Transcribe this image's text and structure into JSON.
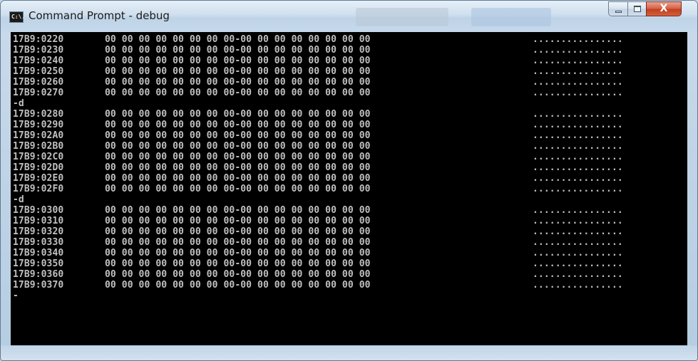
{
  "window": {
    "title": "Command Prompt - debug",
    "icon_label": "C:\\.",
    "controls": {
      "minimize": "minimize-icon",
      "maximize": "maximize-icon",
      "close": "X"
    }
  },
  "console": {
    "lines": [
      {
        "type": "dump",
        "address": "17B9:0220",
        "bytes": "00 00 00 00 00 00 00 00-00 00 00 00 00 00 00 00",
        "ascii": "................"
      },
      {
        "type": "dump",
        "address": "17B9:0230",
        "bytes": "00 00 00 00 00 00 00 00-00 00 00 00 00 00 00 00",
        "ascii": "................"
      },
      {
        "type": "dump",
        "address": "17B9:0240",
        "bytes": "00 00 00 00 00 00 00 00-00 00 00 00 00 00 00 00",
        "ascii": "................"
      },
      {
        "type": "dump",
        "address": "17B9:0250",
        "bytes": "00 00 00 00 00 00 00 00-00 00 00 00 00 00 00 00",
        "ascii": "................"
      },
      {
        "type": "dump",
        "address": "17B9:0260",
        "bytes": "00 00 00 00 00 00 00 00-00 00 00 00 00 00 00 00",
        "ascii": "................"
      },
      {
        "type": "dump",
        "address": "17B9:0270",
        "bytes": "00 00 00 00 00 00 00 00-00 00 00 00 00 00 00 00",
        "ascii": "................"
      },
      {
        "type": "command",
        "text": "-d"
      },
      {
        "type": "dump",
        "address": "17B9:0280",
        "bytes": "00 00 00 00 00 00 00 00-00 00 00 00 00 00 00 00",
        "ascii": "................"
      },
      {
        "type": "dump",
        "address": "17B9:0290",
        "bytes": "00 00 00 00 00 00 00 00-00 00 00 00 00 00 00 00",
        "ascii": "................"
      },
      {
        "type": "dump",
        "address": "17B9:02A0",
        "bytes": "00 00 00 00 00 00 00 00-00 00 00 00 00 00 00 00",
        "ascii": "................"
      },
      {
        "type": "dump",
        "address": "17B9:02B0",
        "bytes": "00 00 00 00 00 00 00 00-00 00 00 00 00 00 00 00",
        "ascii": "................"
      },
      {
        "type": "dump",
        "address": "17B9:02C0",
        "bytes": "00 00 00 00 00 00 00 00-00 00 00 00 00 00 00 00",
        "ascii": "................"
      },
      {
        "type": "dump",
        "address": "17B9:02D0",
        "bytes": "00 00 00 00 00 00 00 00-00 00 00 00 00 00 00 00",
        "ascii": "................"
      },
      {
        "type": "dump",
        "address": "17B9:02E0",
        "bytes": "00 00 00 00 00 00 00 00-00 00 00 00 00 00 00 00",
        "ascii": "................"
      },
      {
        "type": "dump",
        "address": "17B9:02F0",
        "bytes": "00 00 00 00 00 00 00 00-00 00 00 00 00 00 00 00",
        "ascii": "................"
      },
      {
        "type": "command",
        "text": "-d"
      },
      {
        "type": "dump",
        "address": "17B9:0300",
        "bytes": "00 00 00 00 00 00 00 00-00 00 00 00 00 00 00 00",
        "ascii": "................"
      },
      {
        "type": "dump",
        "address": "17B9:0310",
        "bytes": "00 00 00 00 00 00 00 00-00 00 00 00 00 00 00 00",
        "ascii": "................"
      },
      {
        "type": "dump",
        "address": "17B9:0320",
        "bytes": "00 00 00 00 00 00 00 00-00 00 00 00 00 00 00 00",
        "ascii": "................"
      },
      {
        "type": "dump",
        "address": "17B9:0330",
        "bytes": "00 00 00 00 00 00 00 00-00 00 00 00 00 00 00 00",
        "ascii": "................"
      },
      {
        "type": "dump",
        "address": "17B9:0340",
        "bytes": "00 00 00 00 00 00 00 00-00 00 00 00 00 00 00 00",
        "ascii": "................"
      },
      {
        "type": "dump",
        "address": "17B9:0350",
        "bytes": "00 00 00 00 00 00 00 00-00 00 00 00 00 00 00 00",
        "ascii": "................"
      },
      {
        "type": "dump",
        "address": "17B9:0360",
        "bytes": "00 00 00 00 00 00 00 00-00 00 00 00 00 00 00 00",
        "ascii": "................"
      },
      {
        "type": "dump",
        "address": "17B9:0370",
        "bytes": "00 00 00 00 00 00 00 00-00 00 00 00 00 00 00 00",
        "ascii": "................"
      },
      {
        "type": "command",
        "text": "-"
      }
    ]
  }
}
